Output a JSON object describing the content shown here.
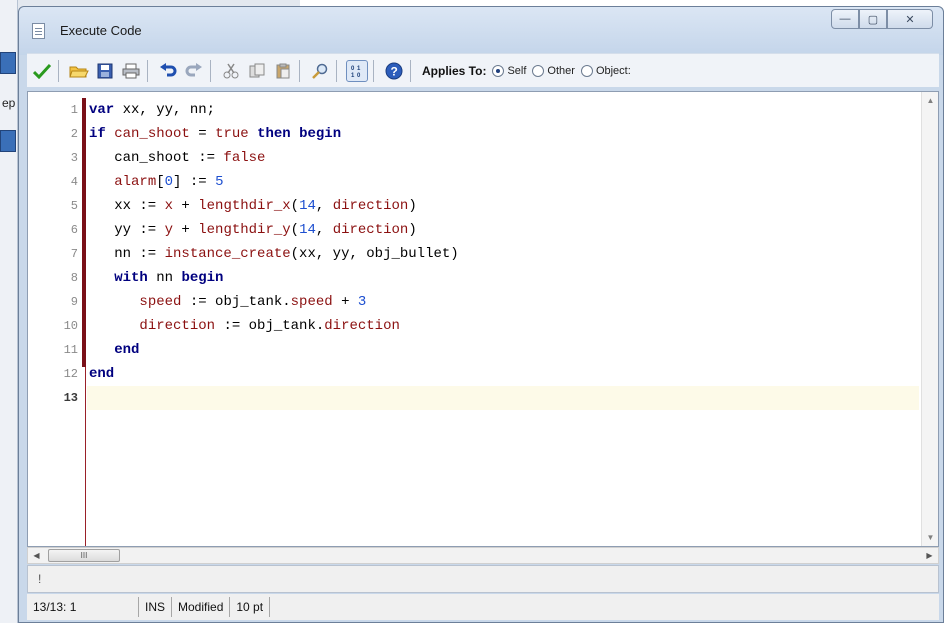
{
  "window": {
    "title": "Execute Code"
  },
  "title_buttons": {
    "minimize": "—",
    "maximize": "▢",
    "close": "✕"
  },
  "toolbar": {
    "applies_to_label": "Applies To:",
    "options": [
      {
        "label": "Self",
        "checked": true
      },
      {
        "label": "Other",
        "checked": false
      },
      {
        "label": "Object:",
        "checked": false
      }
    ]
  },
  "editor": {
    "line_numbers": [
      "1",
      "2",
      "3",
      "4",
      "5",
      "6",
      "7",
      "8",
      "9",
      "10",
      "11",
      "12",
      "13"
    ],
    "current_line": "13"
  },
  "message_bar": {
    "text": "!"
  },
  "status": {
    "position": "13/13:  1",
    "mode": "INS",
    "state": "Modified",
    "font_size": "10 pt"
  },
  "scroll": {
    "thumb_label": "III"
  },
  "colors": {
    "keyword": "#00007f",
    "builtin": "#8b1010",
    "number": "#1d4fd0",
    "gutter_bar": "#7a1018",
    "current_line_bg": "#fdfae8"
  },
  "background_window": {
    "fragment_text": "ep"
  }
}
